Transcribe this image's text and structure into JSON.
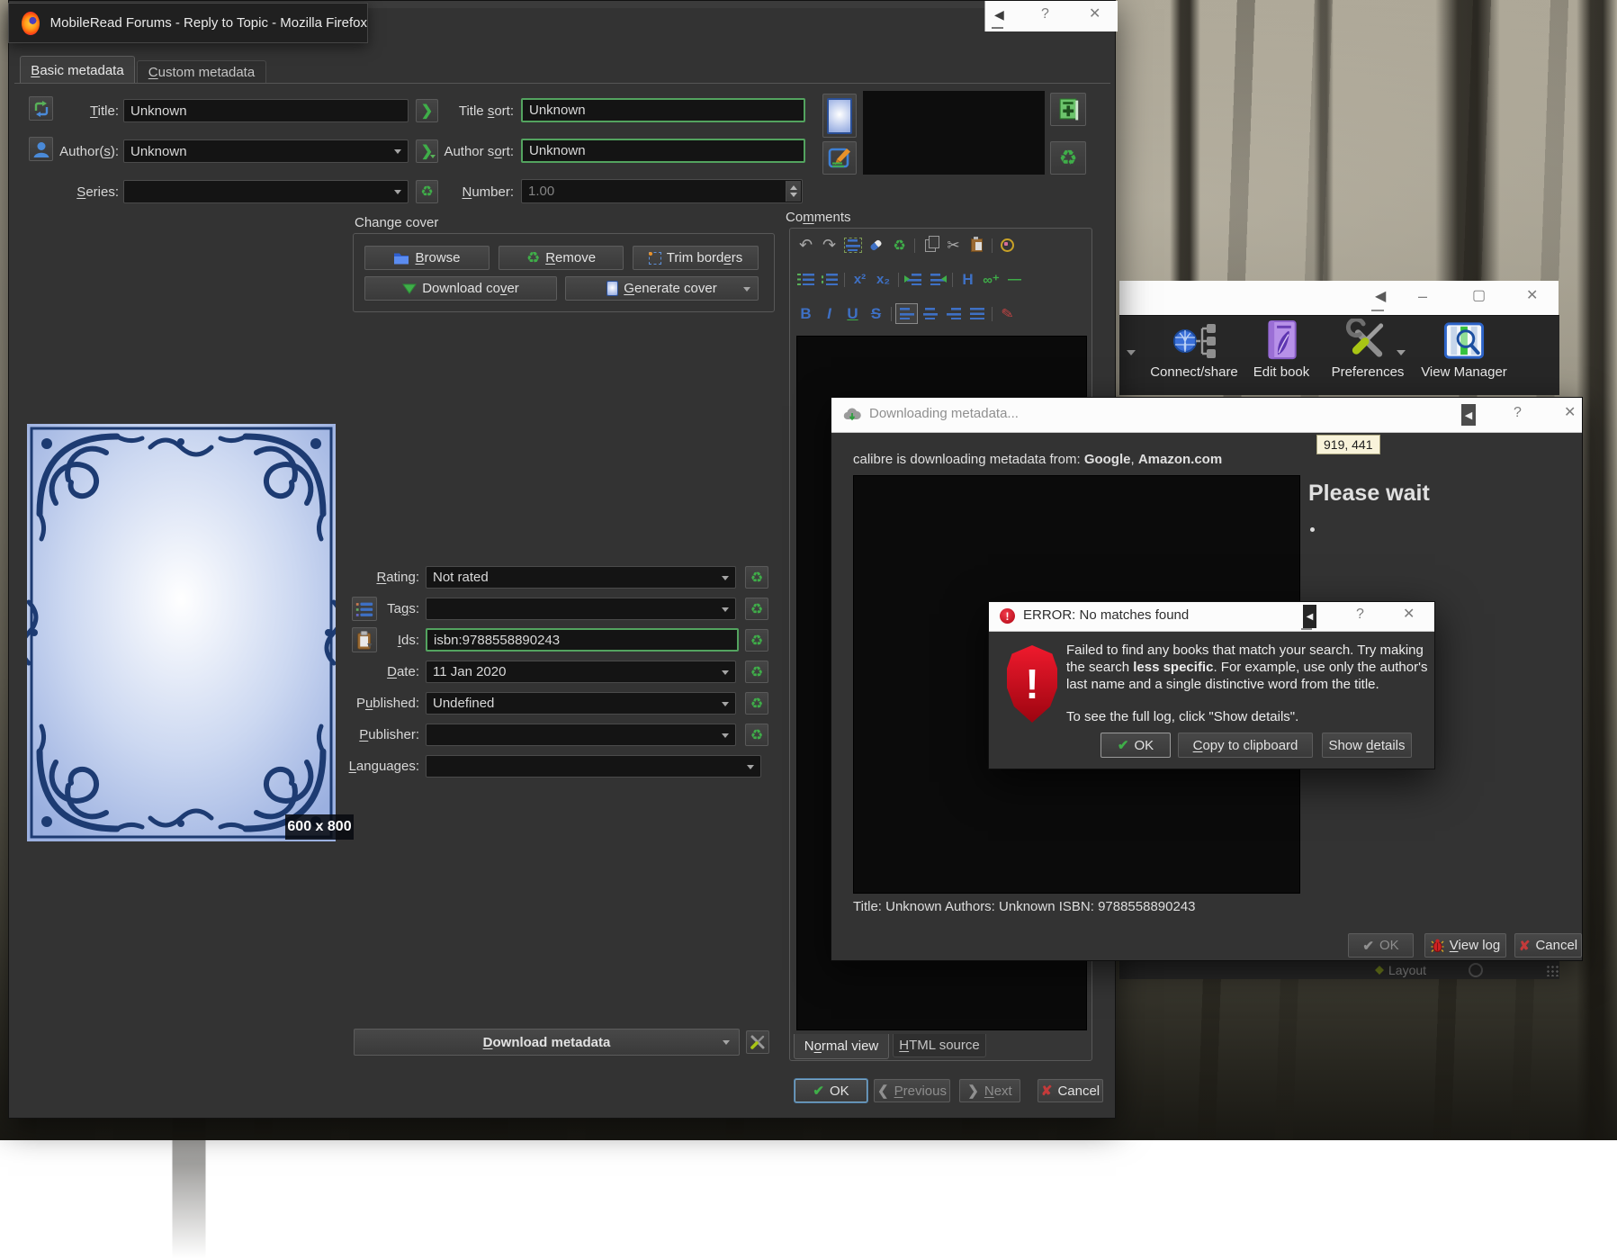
{
  "colors": {
    "accent_green": "#3fae49",
    "field_highlight_green": "#53a35f",
    "error_red": "#d50f1f",
    "toolbar_blue": "#3e70c4"
  },
  "icons": {
    "recycle": "♻",
    "check": "✔",
    "cross": "✘",
    "chevron_right": "❯",
    "chevron_left": "❮",
    "undo": "↶",
    "redo": "↷",
    "scissors": "✂",
    "question": "?",
    "close": "✕",
    "back": "◀",
    "minimize": "–",
    "maximize": "▢",
    "superscript": "x²",
    "subscript": "x₂",
    "heading": "H",
    "link": "∞⁺",
    "hrule": "—",
    "bold": "B",
    "italic": "I",
    "underline": "U",
    "strike": "S",
    "pen": "✎"
  },
  "firefox_tooltip": {
    "title": "MobileRead Forums - Reply to Topic - Mozilla Firefox"
  },
  "metadata_dialog": {
    "tabs": {
      "basic": "Basic metadata",
      "custom": "Custom metadata"
    },
    "title_label": "Title:",
    "title_value": "Unknown",
    "title_sort_label": "Title sort:",
    "title_sort_value": "Unknown",
    "authors_label": "Author(s):",
    "authors_value": "Unknown",
    "author_sort_label": "Author sort:",
    "author_sort_value": "Unknown",
    "series_label": "Series:",
    "series_value": "",
    "number_label": "Number:",
    "number_value": "1.00",
    "change_cover": {
      "title": "Change cover",
      "browse": "Browse",
      "remove": "Remove",
      "trim": "Trim borders",
      "download": "Download cover",
      "generate": "Generate cover"
    },
    "comments": {
      "title": "Comments",
      "normal_tab": "Normal view",
      "html_tab": "HTML source"
    },
    "cover_size": "600 x 800",
    "rating_label": "Rating:",
    "rating_value": "Not rated",
    "tags_label": "Tags:",
    "tags_value": "",
    "ids_label": "Ids:",
    "ids_value": "isbn:9788558890243",
    "date_label": "Date:",
    "date_value": "11 Jan 2020",
    "published_label": "Published:",
    "published_value": "Undefined",
    "publisher_label": "Publisher:",
    "publisher_value": "",
    "languages_label": "Languages:",
    "languages_value": "",
    "download_metadata": "Download metadata",
    "ok": "OK",
    "previous": "Previous",
    "next": "Next",
    "cancel": "Cancel"
  },
  "download_dialog": {
    "title": "Downloading metadata...",
    "source_prefix": "calibre is downloading metadata from: ",
    "source_1": "Google",
    "separator": ", ",
    "source_2": "Amazon.com",
    "please_wait": "Please wait",
    "coords_tooltip": "919, 441",
    "status": "Title: Unknown Authors: Unknown ISBN: 9788558890243",
    "ok": "OK",
    "view_log": "View log",
    "cancel": "Cancel"
  },
  "error_dialog": {
    "title": "ERROR: No matches found",
    "exclamation": "!",
    "msg_1": "Failed to find any books that match your search. Try making the search ",
    "msg_bold": "less specific",
    "msg_2": ". For example, use only the author's last name and a single distinctive word from the title.",
    "msg_3": "To see the full log, click \"Show details\".",
    "ok": "OK",
    "copy": "Copy to clipboard",
    "details": "Show details"
  },
  "main_window": {
    "toolbar": {
      "connect": "Connect/share",
      "edit": "Edit book",
      "prefs": "Preferences",
      "view": "View Manager"
    },
    "layout": "Layout"
  }
}
